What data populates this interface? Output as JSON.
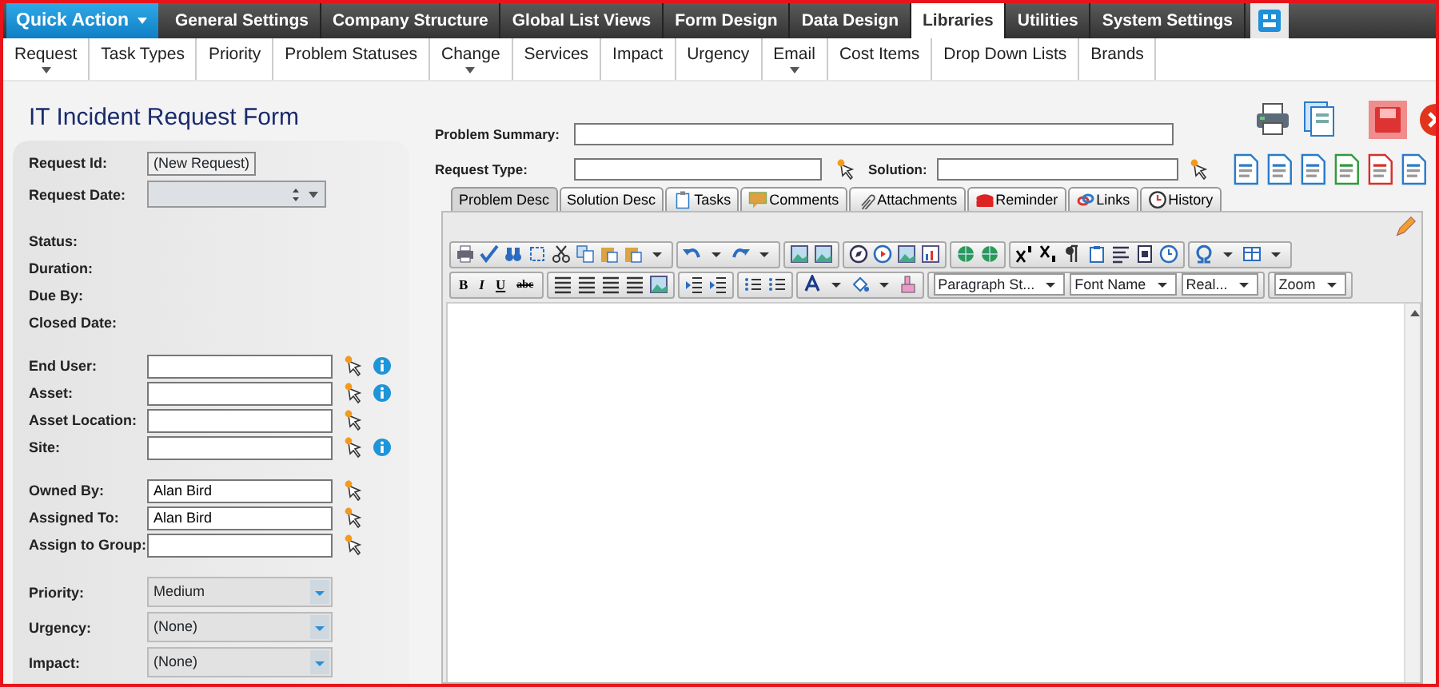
{
  "top_nav": {
    "quick_action": "Quick Action",
    "items": [
      {
        "label": "General Settings",
        "selected": false
      },
      {
        "label": "Company Structure",
        "selected": false
      },
      {
        "label": "Global List Views",
        "selected": false
      },
      {
        "label": "Form Design",
        "selected": false
      },
      {
        "label": "Data Design",
        "selected": false
      },
      {
        "label": "Libraries",
        "selected": true
      },
      {
        "label": "Utilities",
        "selected": false
      },
      {
        "label": "System Settings",
        "selected": false
      }
    ]
  },
  "sub_nav": [
    {
      "label": "Request",
      "has_menu": true
    },
    {
      "label": "Task Types",
      "has_menu": false
    },
    {
      "label": "Priority",
      "has_menu": false
    },
    {
      "label": "Problem Statuses",
      "has_menu": false
    },
    {
      "label": "Change",
      "has_menu": true
    },
    {
      "label": "Services",
      "has_menu": false
    },
    {
      "label": "Impact",
      "has_menu": false
    },
    {
      "label": "Urgency",
      "has_menu": false
    },
    {
      "label": "Email",
      "has_menu": true
    },
    {
      "label": "Cost Items",
      "has_menu": false
    },
    {
      "label": "Drop Down Lists",
      "has_menu": false
    },
    {
      "label": "Brands",
      "has_menu": false
    }
  ],
  "form_title": "IT Incident Request Form",
  "field_groups": [
    [
      {
        "kind": "readonly",
        "label": "Request Id:",
        "value": "(New Request)"
      },
      {
        "kind": "date",
        "label": "Request Date:"
      }
    ],
    [
      {
        "kind": "text",
        "label": "Status:"
      },
      {
        "kind": "text",
        "label": "Duration:"
      },
      {
        "kind": "text",
        "label": "Due By:"
      },
      {
        "kind": "text",
        "label": "Closed Date:"
      }
    ],
    [
      {
        "kind": "lookup",
        "label": "End User:",
        "info": true
      },
      {
        "kind": "lookup",
        "label": "Asset:",
        "info": true
      },
      {
        "kind": "lookup",
        "label": "Asset Location:",
        "info": false
      },
      {
        "kind": "lookup",
        "label": "Site:",
        "info": true
      }
    ],
    [
      {
        "kind": "lookup",
        "label": "Owned By:",
        "value": "Alan Bird",
        "info": false
      },
      {
        "kind": "lookup",
        "label": "Assigned To:",
        "value": "Alan Bird",
        "info": false
      },
      {
        "kind": "lookup",
        "label": "Assign to Group:",
        "info": false
      }
    ],
    [
      {
        "kind": "select",
        "label": "Priority:",
        "value": "Medium"
      },
      {
        "kind": "select",
        "label": "Urgency:",
        "value": "(None)"
      },
      {
        "kind": "select",
        "label": "Impact:",
        "value": "(None)"
      }
    ]
  ],
  "problem_summary": {
    "label": "Problem Summary:"
  },
  "request_type": {
    "label": "Request Type:"
  },
  "solution": {
    "label": "Solution:"
  },
  "tabs": [
    {
      "label": "Problem Desc",
      "selected": true
    },
    {
      "label": "Solution Desc",
      "selected": false
    },
    {
      "label": "Tasks",
      "selected": false
    },
    {
      "label": "Comments",
      "selected": false
    },
    {
      "label": "Attachments",
      "selected": false
    },
    {
      "label": "Reminder",
      "selected": false
    },
    {
      "label": "Links",
      "selected": false
    },
    {
      "label": "History",
      "selected": false
    }
  ],
  "editor": {
    "format_buttons": [
      "B",
      "I",
      "U",
      "abc"
    ],
    "dropdowns": [
      {
        "label": "Paragraph St..."
      },
      {
        "label": "Font Name"
      },
      {
        "label": "Real..."
      },
      {
        "label": "Zoom"
      }
    ]
  }
}
